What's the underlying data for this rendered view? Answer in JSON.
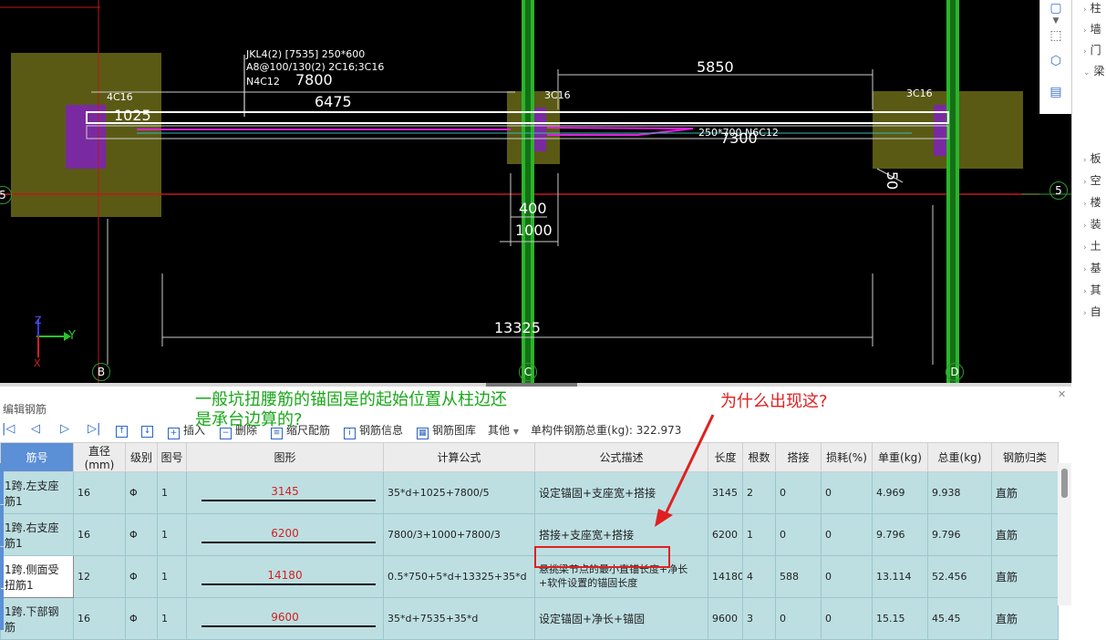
{
  "cad": {
    "beam_label_line1": "JKL4(2) [7535] 250*600",
    "beam_label_line2": "A8@100/130(2) 2C16;3C16",
    "beam_label_line3": "N4C12",
    "dim_7800": "7800",
    "dim_6475": "6475",
    "dim_5850": "5850",
    "dim_1025": "1025",
    "rebar_4c16": "4C16",
    "rebar_3c16_mid": "3C16",
    "rebar_3c16_right": "3C16",
    "rebar_250": "250*700 N6C12",
    "dim_7300": "7300",
    "dim_50": "50",
    "dim_400": "400",
    "dim_1000": "1000",
    "dim_13325": "13325",
    "axis_5_left": "5",
    "axis_5_right": "5",
    "axis_b": "B",
    "axis_c": "C",
    "axis_d": "D",
    "coord_z": "Z",
    "coord_y": "Y",
    "coord_x": "X"
  },
  "right_panel": {
    "items": [
      "柱",
      "墙",
      "门",
      "梁",
      "板",
      "空",
      "楼",
      "装",
      "土",
      "基",
      "其",
      "自"
    ]
  },
  "editor": {
    "title": "编辑钢筋",
    "toolbar": {
      "insert": "插入",
      "delete": "删除",
      "scale": "缩尺配筋",
      "rebar_info": "钢筋信息",
      "rebar_lib": "钢筋图库",
      "other": "其他",
      "total_weight": "单构件钢筋总重(kg): 322.973"
    },
    "columns": [
      "筋号",
      "直径(mm)",
      "级别",
      "图号",
      "图形",
      "计算公式",
      "公式描述",
      "长度",
      "根数",
      "搭接",
      "损耗(%)",
      "单重(kg)",
      "总重(kg)",
      "钢筋归类"
    ],
    "rows": [
      {
        "name": "1跨.左支座筋1",
        "dia": "16",
        "grade": "Φ",
        "fig": "1",
        "shape": "3145",
        "formula": "35*d+1025+7800/5",
        "desc": "设定锚固+支座宽+搭接",
        "length": "3145",
        "count": "2",
        "lap": "0",
        "loss": "0",
        "unit": "4.969",
        "total": "9.938",
        "cat": "直筋"
      },
      {
        "name": "1跨.右支座筋1",
        "dia": "16",
        "grade": "Φ",
        "fig": "1",
        "shape": "6200",
        "formula": "7800/3+1000+7800/3",
        "desc": "搭接+支座宽+搭接",
        "length": "6200",
        "count": "1",
        "lap": "0",
        "loss": "0",
        "unit": "9.796",
        "total": "9.796",
        "cat": "直筋"
      },
      {
        "name": "1跨.侧面受扭筋1",
        "dia": "12",
        "grade": "Φ",
        "fig": "1",
        "shape": "14180",
        "formula": "0.5*750+5*d+13325+35*d",
        "desc": "悬挑梁节点的最小直锚长度+净长+软件设置的锚固长度",
        "length": "14180",
        "count": "4",
        "lap": "588",
        "loss": "0",
        "unit": "13.114",
        "total": "52.456",
        "cat": "直筋"
      },
      {
        "name": "1跨.下部钢筋",
        "dia": "16",
        "grade": "Φ",
        "fig": "1",
        "shape": "9600",
        "formula": "35*d+7535+35*d",
        "desc": "设定锚固+净长+锚固",
        "length": "9600",
        "count": "3",
        "lap": "0",
        "loss": "0",
        "unit": "15.15",
        "total": "45.45",
        "cat": "直筋"
      }
    ]
  },
  "annotations": {
    "green_note": "一般坑扭腰筋的锚固是的起始位置从柱边还是承台边算的?",
    "red_question": "为什么出现这?"
  },
  "colors": {
    "cad_bg": "#000000",
    "column_green": "#2bb52b",
    "beam_white": "#ffffff",
    "rebar_magenta": "#e020e0",
    "pile_cap": "#5a5a14",
    "purple": "#7a2aa0",
    "axis_red": "#c01818",
    "row_teal": "#bddfe2",
    "highlight_red": "#e02020",
    "note_green": "#1aa81a"
  }
}
